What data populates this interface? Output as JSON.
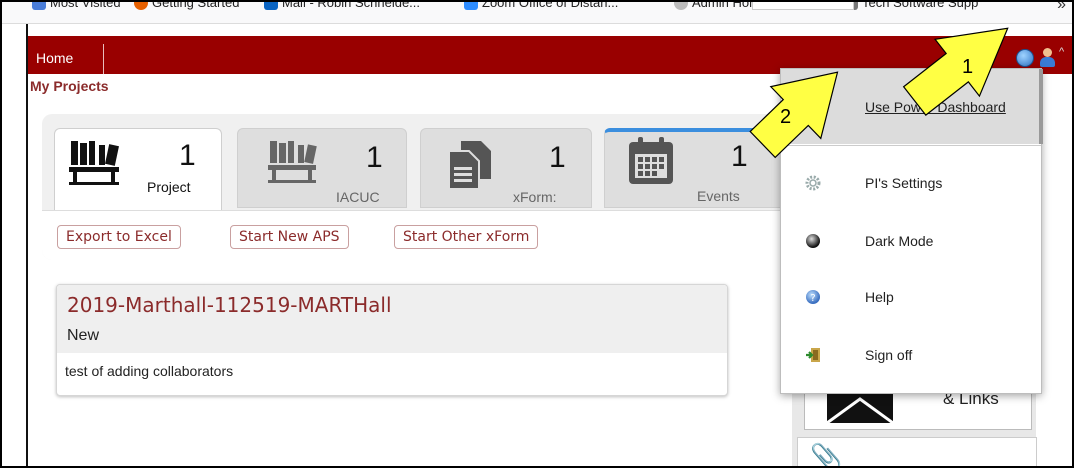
{
  "browser": {
    "bookmarks": [
      {
        "label": "Most Visited",
        "icon": "gear-icon",
        "color": "#4a7dd8"
      },
      {
        "label": "Getting Started",
        "icon": "firefox-icon",
        "color": "#e66000"
      },
      {
        "label": "Mail - Robin Schneide...",
        "icon": "outlook-icon",
        "color": "#0a64c2"
      },
      {
        "label": "Zoom Office of Distan...",
        "icon": "zoom-icon",
        "color": "#2d8cff"
      },
      {
        "label": "Admin Home",
        "icon": "globe-icon",
        "color": "#888888"
      },
      {
        "label": "Tech Software Supp",
        "icon": "tool-icon",
        "color": "#555555"
      }
    ],
    "overflow_chevron": "»"
  },
  "header": {
    "home_label": "Home",
    "caret": "^"
  },
  "page": {
    "title": "My Projects"
  },
  "stats": [
    {
      "key": "projects",
      "count": "1",
      "label": "Project"
    },
    {
      "key": "iacuc",
      "count": "1",
      "label": "IACUC"
    },
    {
      "key": "xforms",
      "count": "1",
      "label": "xForm:"
    },
    {
      "key": "events",
      "count": "1",
      "label": "Events"
    }
  ],
  "actions": {
    "export": "Export to Excel",
    "new_aps": "Start New APS",
    "other_xform": "Start Other xForm"
  },
  "project": {
    "title": "2019-Marthall-112519-MARTHall",
    "status": "New",
    "description": "test of adding collaborators"
  },
  "side": {
    "links_label": "& Links"
  },
  "menu": {
    "power_dashboard": "Use Power Dashboard",
    "settings": "PI's Settings",
    "dark_mode": "Dark Mode",
    "help": "Help",
    "sign_off": "Sign off"
  },
  "callouts": {
    "first": "1",
    "second": "2"
  },
  "colors": {
    "brand_red": "#990000",
    "title_red": "#8b2b2b",
    "callout_yellow": "#ffff44",
    "events_accent": "#3b8ede"
  }
}
